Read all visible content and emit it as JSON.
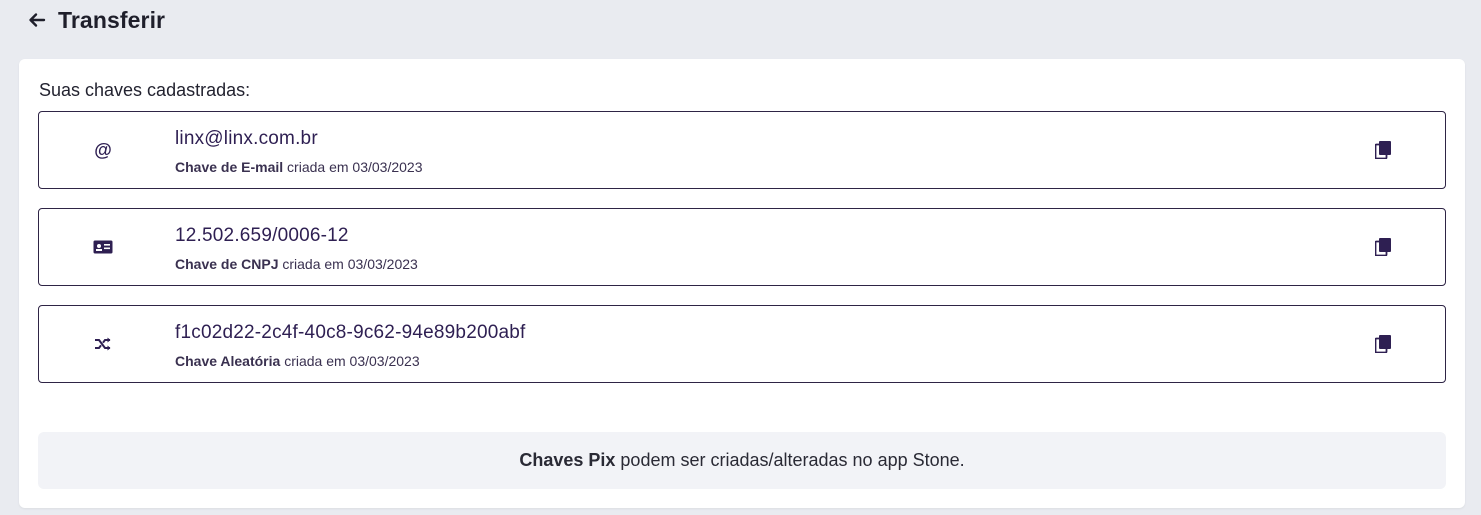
{
  "header": {
    "back_icon": "arrow-left-icon",
    "title": "Transferir"
  },
  "keys_section": {
    "label": "Suas chaves cadastradas:",
    "keys": [
      {
        "icon": "at-sign-icon",
        "value": "linx@linx.com.br",
        "type_label": "Chave de E-mail",
        "created_text": "criada em 03/03/2023",
        "copy_icon": "copy-icon"
      },
      {
        "icon": "id-card-icon",
        "value": "12.502.659/0006-12",
        "type_label": "Chave de CNPJ",
        "created_text": "criada em 03/03/2023",
        "copy_icon": "copy-icon"
      },
      {
        "icon": "shuffle-icon",
        "value": "f1c02d22-2c4f-40c8-9c62-94e89b200abf",
        "type_label": "Chave Aleatória",
        "created_text": "criada em 03/03/2023",
        "copy_icon": "copy-icon"
      }
    ]
  },
  "info": {
    "bold_text": "Chaves Pix",
    "text": "podem ser criadas/alteradas no app Stone."
  },
  "colors": {
    "page_bg": "#e9ebf0",
    "card_bg": "#ffffff",
    "accent": "#2e1f52",
    "info_bg": "#f2f3f7"
  }
}
